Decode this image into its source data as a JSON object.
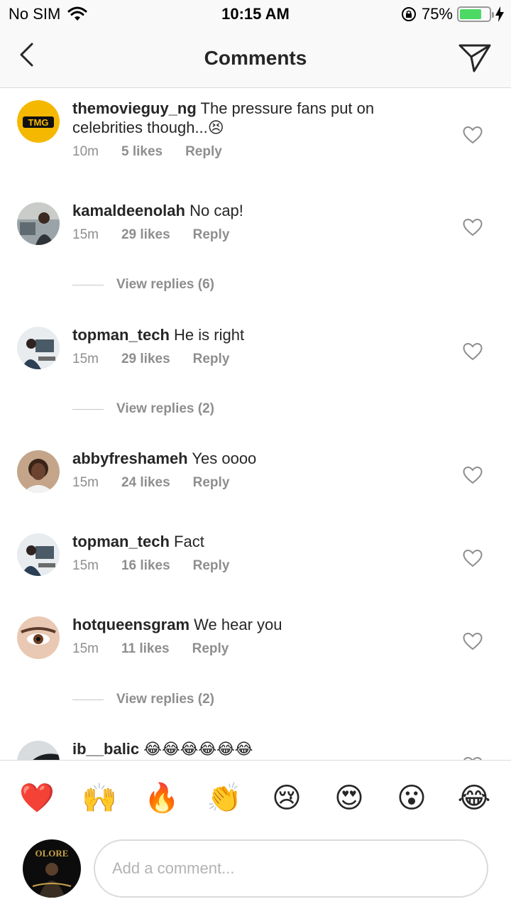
{
  "status_bar": {
    "carrier": "No SIM",
    "time": "10:15 AM",
    "battery_text": "75%",
    "battery_level": 0.75,
    "battery_color": "#4cd964"
  },
  "header": {
    "title": "Comments",
    "back_icon": "chevron-left-icon",
    "send_icon": "paper-plane-icon"
  },
  "comments": [
    {
      "username": "themovieguy_ng",
      "text": "The pressure fans put on celebrities though...😣",
      "time": "10m",
      "likes": "5 likes",
      "reply": "Reply"
    },
    {
      "username": "kamaldeenolah",
      "text": "No cap!",
      "time": "15m",
      "likes": "29 likes",
      "reply": "Reply",
      "view_replies": "View replies (6)"
    },
    {
      "username": "topman_tech",
      "text": "He is right",
      "time": "15m",
      "likes": "29 likes",
      "reply": "Reply",
      "view_replies": "View replies (2)"
    },
    {
      "username": "abbyfreshameh",
      "text": "Yes oooo",
      "time": "15m",
      "likes": "24 likes",
      "reply": "Reply"
    },
    {
      "username": "topman_tech",
      "text": "Fact",
      "time": "15m",
      "likes": "16 likes",
      "reply": "Reply"
    },
    {
      "username": "hotqueensgram",
      "text": "We hear you",
      "time": "15m",
      "likes": "11 likes",
      "reply": "Reply",
      "view_replies": "View replies (2)"
    },
    {
      "username": "ib__balic",
      "text": "😂😂😂😂😂😂"
    }
  ],
  "avatar_badges": {
    "tmg": "TMG"
  },
  "emoji_bar": [
    "❤️",
    "🙌",
    "🔥",
    "👏",
    "😢",
    "😍",
    "😮",
    "😂"
  ],
  "compose": {
    "placeholder": "Add a comment...",
    "avatar_text": "OLORE"
  }
}
